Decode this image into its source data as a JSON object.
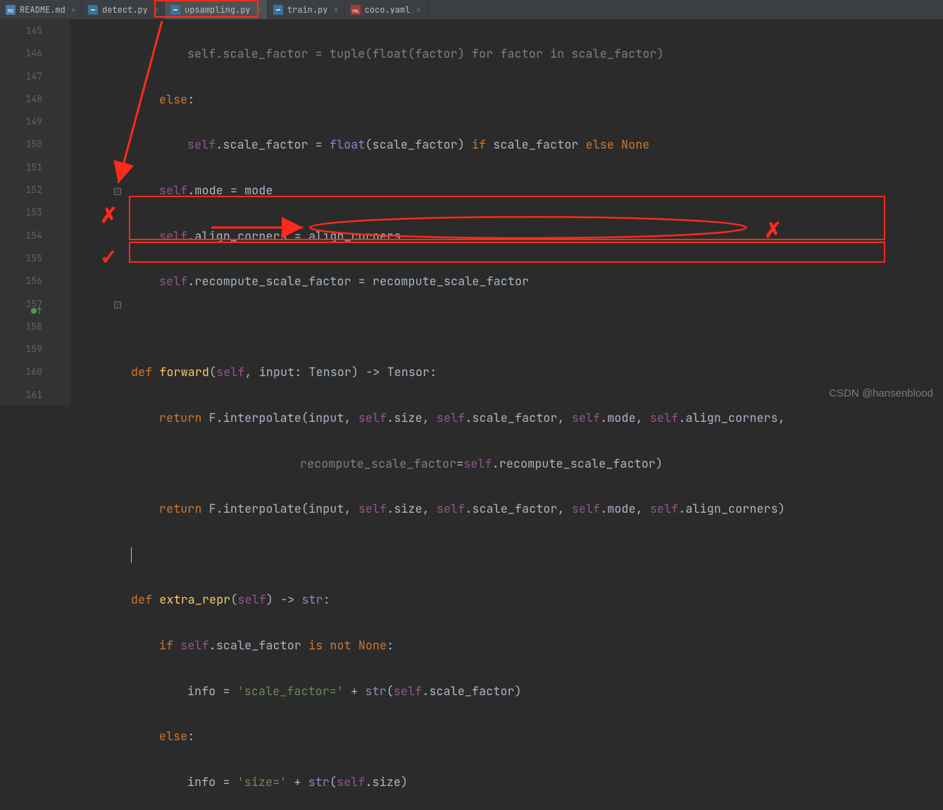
{
  "tabs": [
    {
      "label": "README.md",
      "icon": "md",
      "active": false
    },
    {
      "label": "detect.py",
      "icon": "py",
      "active": false
    },
    {
      "label": "upsampling.py",
      "icon": "py",
      "active": true
    },
    {
      "label": "train.py",
      "icon": "py",
      "active": false
    },
    {
      "label": "coco.yaml",
      "icon": "yml",
      "active": false
    }
  ],
  "line_numbers": [
    "145",
    "146",
    "147",
    "148",
    "149",
    "150",
    "151",
    "152",
    "153",
    "154",
    "155",
    "156",
    "157",
    "158",
    "159",
    "160",
    "161"
  ],
  "code": {
    "l145": {
      "self": "self",
      "attr": ".scale_factor = ",
      "fn": "tuple",
      "p1": "(",
      "fn2": "float",
      "p2": "(factor) ",
      "kw1": "for",
      "p3": " factor ",
      "kw2": "in",
      "p4": " scale_factor)"
    },
    "l146": {
      "kw": "else",
      "colon": ":"
    },
    "l147": {
      "self": "self",
      "attr": ".scale_factor = ",
      "fn": "float",
      "args": "(scale_factor) ",
      "kw1": "if",
      "mid": " scale_factor ",
      "kw2": "else ",
      "none": "None"
    },
    "l148": {
      "self": "self",
      "rest": ".mode = mode"
    },
    "l149": {
      "self": "self",
      "rest": ".align_corners = align_corners"
    },
    "l150": {
      "self": "self",
      "rest": ".recompute_scale_factor = recompute_scale_factor"
    },
    "l152": {
      "kw": "def ",
      "fn": "forward",
      "p1": "(",
      "self": "self",
      "p2": ", ",
      "arg": "input",
      "p3": ": Tensor) -> Tensor:"
    },
    "l153": {
      "kw": "return ",
      "F": "F.interpolate(input, ",
      "s1": "self",
      "a1": ".size, ",
      "s2": "self",
      "a2": ".scale_factor, ",
      "s3": "self",
      "a3": ".mode, ",
      "s4": "self",
      "a4": ".align_corners,"
    },
    "l154": {
      "arg": "recompute_scale_factor",
      "eq": "=",
      "self": "self",
      "rest": ".recompute_scale_factor)"
    },
    "l155": {
      "kw": "return ",
      "F": "F.interpolate(input, ",
      "s1": "self",
      "a1": ".size, ",
      "s2": "self",
      "a2": ".scale_factor, ",
      "s3": "self",
      "a3": ".mode, ",
      "s4": "self",
      "a4": ".align_corners)"
    },
    "l157": {
      "kw": "def ",
      "fn": "extra_repr",
      "p1": "(",
      "self": "self",
      "p2": ") -> ",
      "type": "str",
      "colon": ":"
    },
    "l158": {
      "kw1": "if ",
      "self": "self",
      "attr": ".scale_factor ",
      "kw2": "is not ",
      "none": "None",
      "colon": ":"
    },
    "l159": {
      "var": "info = ",
      "str": "'scale_factor='",
      "plus": " + ",
      "fn": "str",
      "p1": "(",
      "self": "self",
      "rest": ".scale_factor)"
    },
    "l160": {
      "kw": "else",
      "colon": ":"
    },
    "l161": {
      "var": "info = ",
      "str": "'size='",
      "plus": " + ",
      "fn": "str",
      "p1": "(",
      "self": "self",
      "rest": ".size)"
    }
  },
  "watermark": "CSDN @hansenblood",
  "annotations": {
    "x1_symbol": "✗",
    "x2_symbol": "✗",
    "check_symbol": "✓"
  }
}
